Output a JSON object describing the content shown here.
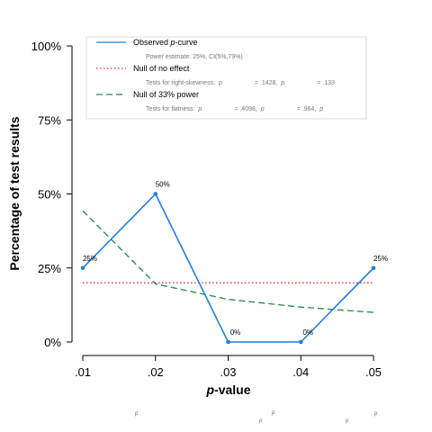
{
  "chart_data": {
    "type": "line",
    "xlabel": "p-value",
    "ylabel": "Percentage of test results",
    "x": [
      0.01,
      0.02,
      0.03,
      0.04,
      0.05
    ],
    "x_tick_labels": [
      ".01",
      ".02",
      ".03",
      ".04",
      ".05"
    ],
    "ylim": [
      0,
      100
    ],
    "y_ticks": [
      0,
      25,
      50,
      75,
      100
    ],
    "y_tick_labels": [
      "0%",
      "25%",
      "50%",
      "75%",
      "100%"
    ],
    "grid": false,
    "legend_position": "top",
    "series": [
      {
        "name": "Observed p-curve",
        "color": "#1f7fdb",
        "style": "solid",
        "markers": true,
        "values": [
          25,
          50,
          0,
          0,
          25
        ],
        "data_labels": [
          "25%",
          "50%",
          "0%",
          "0%",
          "25%"
        ]
      },
      {
        "name": "Null of no effect",
        "color": "#e0302a",
        "style": "dotted",
        "markers": false,
        "values": [
          20,
          20,
          20,
          20,
          20
        ]
      },
      {
        "name": "Null of 33% power",
        "color": "#1e8a4c",
        "style": "dashed",
        "markers": false,
        "values": [
          44.3,
          19.6,
          14.4,
          11.8,
          10.0
        ]
      }
    ],
    "legend": [
      {
        "label": "Observed ",
        "label_italic": "p",
        "label_rest": "-curve",
        "sub": "Power estimate: 25%, CI(5%,79%)"
      },
      {
        "label": "Null of no effect",
        "label_italic": "",
        "label_rest": "",
        "sub_parts": [
          "Tests for right-skewness: ",
          "p",
          "= .1428,  ",
          "p",
          "= .133"
        ]
      },
      {
        "label": "Null of 33% power",
        "label_italic": "",
        "label_rest": "",
        "sub_parts": [
          "Tests for flatness: ",
          "p",
          "= .4098,  ",
          "p",
          "= .964,  ",
          "p"
        ]
      }
    ],
    "footer_fragments": [
      "p",
      "p",
      "p",
      "p",
      "p"
    ]
  }
}
